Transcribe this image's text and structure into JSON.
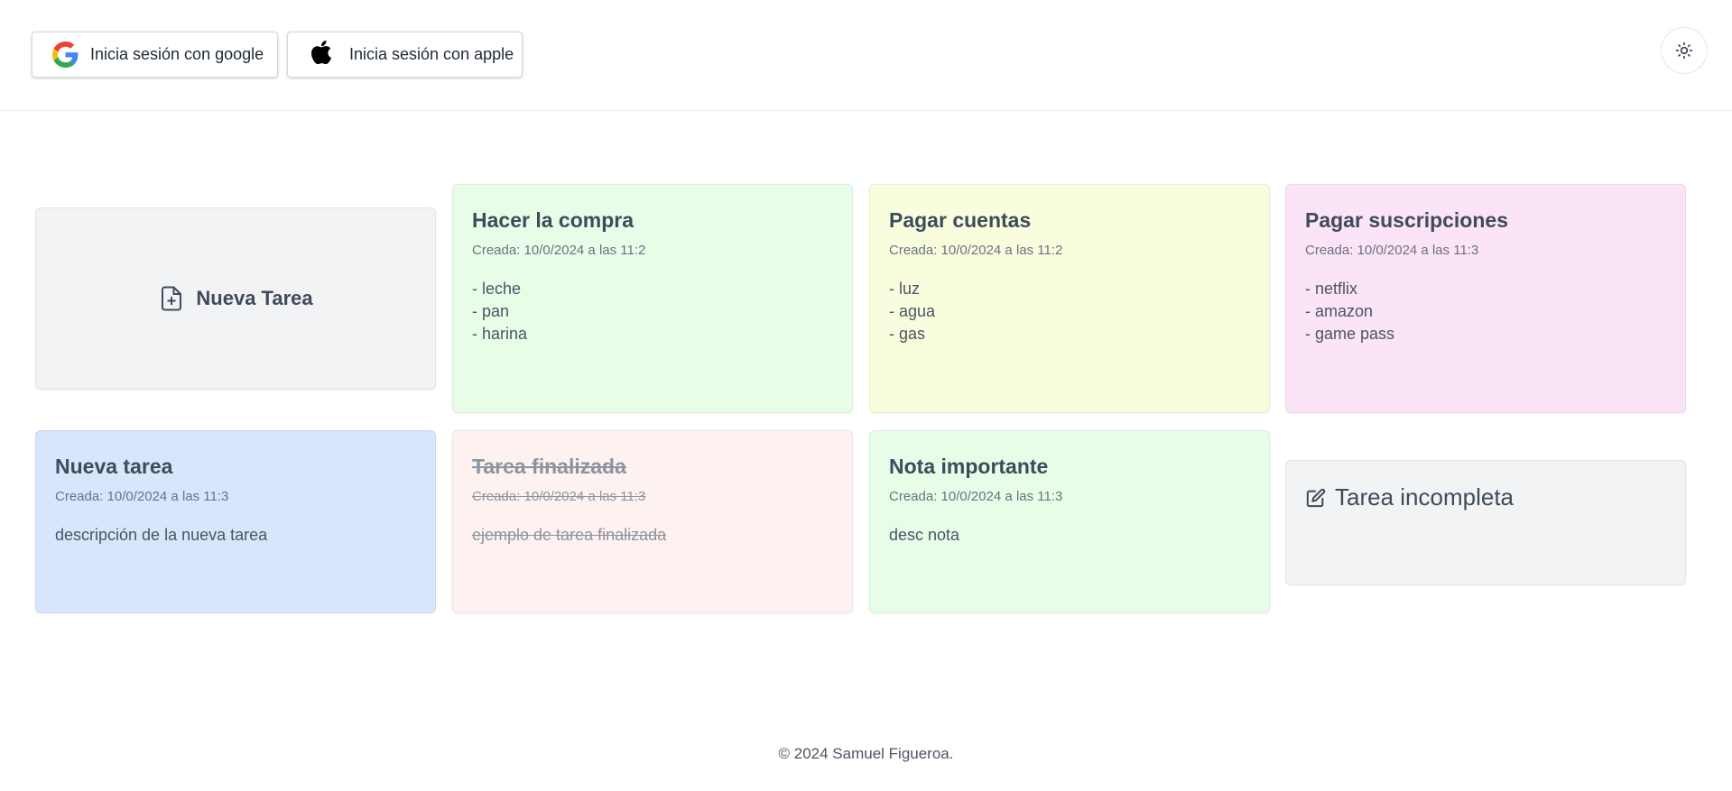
{
  "header": {
    "google_button_label": "Inicia sesión con google",
    "apple_button_label": "Inicia sesión con apple",
    "theme_toggle_icon": "sun-icon"
  },
  "new_task_card": {
    "label": "Nueva Tarea",
    "icon": "file-plus-icon"
  },
  "tasks": [
    {
      "title": "Hacer la compra",
      "created": "Creada: 10/0/2024 a las 11:2",
      "description": "- leche\n- pan\n- harina",
      "color": "#e8fde8",
      "done": false
    },
    {
      "title": "Pagar cuentas",
      "created": "Creada: 10/0/2024 a las 11:2",
      "description": "- luz\n- agua\n- gas",
      "color": "#f8fedd",
      "done": false
    },
    {
      "title": "Pagar suscripciones",
      "created": "Creada: 10/0/2024 a las 11:3",
      "description": "- netflix\n- amazon\n- game pass",
      "color": "#fbe4f6",
      "done": false
    },
    {
      "title": "Nueva tarea",
      "created": "Creada: 10/0/2024 a las 11:3",
      "description": "descripción de la nueva tarea",
      "color": "#d8e6fb",
      "done": false
    },
    {
      "title": "Tarea finalizada",
      "created": "Creada: 10/0/2024 a las 11:3",
      "description": "ejemplo de tarea finalizada",
      "color": "#fdf2ef",
      "done": true
    },
    {
      "title": "Nota importante",
      "created": "Creada: 10/0/2024 a las 11:3",
      "description": "desc nota",
      "color": "#e8fde8",
      "done": false
    }
  ],
  "incomplete_card": {
    "label": "Tarea incompleta",
    "icon": "edit-icon"
  },
  "footer": {
    "text": "© 2024 Samuel Figueroa."
  }
}
